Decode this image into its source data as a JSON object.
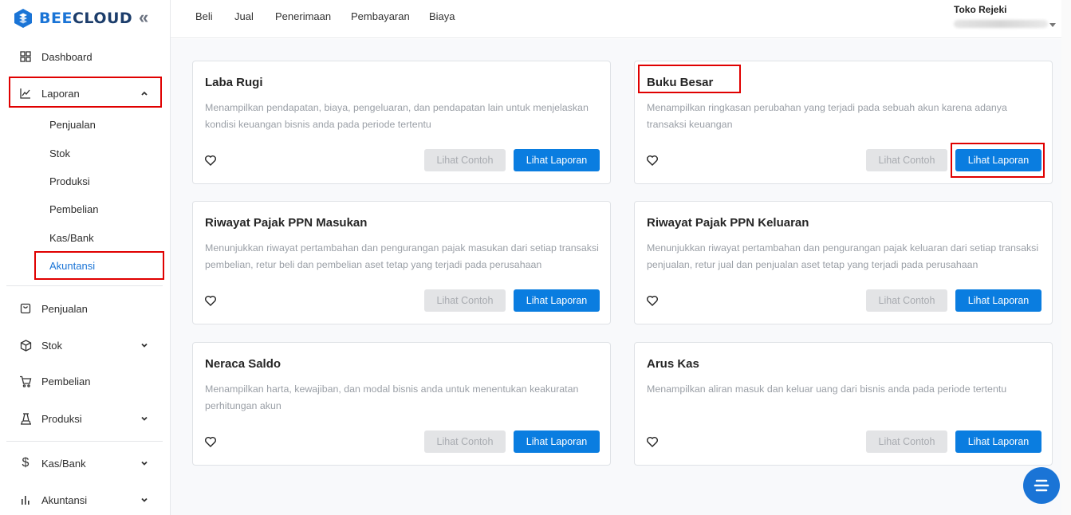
{
  "brand": {
    "part1": "BEE",
    "part2": "CLOUD",
    "color": "#1a74d6",
    "dark_color": "#1c3d6b"
  },
  "sidebar": {
    "items": [
      {
        "label": "Dashboard",
        "icon": "grid-icon"
      },
      {
        "label": "Laporan",
        "icon": "line-chart-icon",
        "expanded": true
      },
      {
        "label": "Penjualan",
        "icon": "receipt-icon"
      },
      {
        "label": "Stok",
        "icon": "box-icon"
      },
      {
        "label": "Pembelian",
        "icon": "cart-icon"
      },
      {
        "label": "Produksi",
        "icon": "factory-icon"
      },
      {
        "label": "Kas/Bank",
        "icon": "dollar-icon"
      },
      {
        "label": "Akuntansi",
        "icon": "bar-chart-icon"
      }
    ],
    "laporan_sub": [
      "Penjualan",
      "Stok",
      "Produksi",
      "Pembelian",
      "Kas/Bank",
      "Akuntansi"
    ],
    "active_sub": "Akuntansi"
  },
  "topnav": [
    "Beli",
    "Jual",
    "Penerimaan",
    "Pembayaran",
    "Biaya"
  ],
  "store": {
    "name": "Toko Rejeki"
  },
  "cards": [
    {
      "title": "Laba Rugi",
      "desc": "Menampilkan pendapatan, biaya, pengeluaran, dan pendapatan lain untuk menjelaskan kondisi keuangan bisnis anda pada periode tertentu",
      "sample": "Lihat Contoh",
      "report": "Lihat Laporan"
    },
    {
      "title": "Buku Besar",
      "desc": "Menampilkan ringkasan perubahan yang terjadi pada sebuah akun karena adanya transaksi keuangan",
      "sample": "Lihat Contoh",
      "report": "Lihat Laporan"
    },
    {
      "title": "Riwayat Pajak PPN Masukan",
      "desc": "Menunjukkan riwayat pertambahan dan pengurangan pajak masukan dari setiap transaksi pembelian, retur beli dan pembelian aset tetap yang terjadi pada perusahaan",
      "sample": "Lihat Contoh",
      "report": "Lihat Laporan"
    },
    {
      "title": "Riwayat Pajak PPN Keluaran",
      "desc": "Menunjukkan riwayat pertambahan dan pengurangan pajak keluaran dari setiap transaksi penjualan, retur jual dan penjualan aset tetap yang terjadi pada perusahaan",
      "sample": "Lihat Contoh",
      "report": "Lihat Laporan"
    },
    {
      "title": "Neraca Saldo",
      "desc": "Menampilkan harta, kewajiban, dan modal bisnis anda untuk menentukan keakuratan perhitungan akun",
      "sample": "Lihat Contoh",
      "report": "Lihat Laporan"
    },
    {
      "title": "Arus Kas",
      "desc": "Menampilkan aliran masuk dan keluar uang dari bisnis anda pada periode tertentu",
      "sample": "Lihat Contoh",
      "report": "Lihat Laporan"
    }
  ],
  "colors": {
    "primary": "#0a7de0",
    "highlight": "#e00000",
    "active": "#1a74d6"
  }
}
